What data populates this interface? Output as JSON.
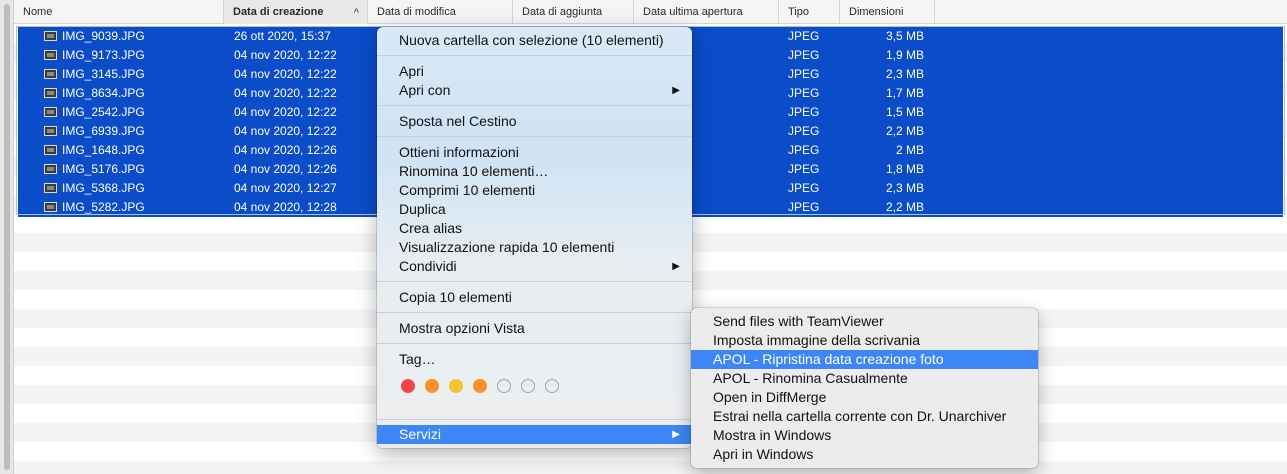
{
  "columns": {
    "name": "Nome",
    "created": "Data di creazione",
    "modified": "Data di modifica",
    "added": "Data di aggiunta",
    "last_opened": "Data ultima apertura",
    "type": "Tipo",
    "size": "Dimensioni"
  },
  "sort_indicator": "^",
  "files": [
    {
      "name": "IMG_9039.JPG",
      "created": "26 ott 2020, 15:37",
      "type": "JPEG",
      "size": "3,5 MB"
    },
    {
      "name": "IMG_9173.JPG",
      "created": "04 nov 2020, 12:22",
      "type": "JPEG",
      "size": "1,9 MB"
    },
    {
      "name": "IMG_3145.JPG",
      "created": "04 nov 2020, 12:22",
      "type": "JPEG",
      "size": "2,3 MB"
    },
    {
      "name": "IMG_8634.JPG",
      "created": "04 nov 2020, 12:22",
      "type": "JPEG",
      "size": "1,7 MB"
    },
    {
      "name": "IMG_2542.JPG",
      "created": "04 nov 2020, 12:22",
      "type": "JPEG",
      "size": "1,5 MB"
    },
    {
      "name": "IMG_6939.JPG",
      "created": "04 nov 2020, 12:22",
      "type": "JPEG",
      "size": "2,2 MB"
    },
    {
      "name": "IMG_1648.JPG",
      "created": "04 nov 2020, 12:26",
      "type": "JPEG",
      "size": "2 MB"
    },
    {
      "name": "IMG_5176.JPG",
      "created": "04 nov 2020, 12:26",
      "type": "JPEG",
      "size": "1,8 MB"
    },
    {
      "name": "IMG_5368.JPG",
      "created": "04 nov 2020, 12:27",
      "type": "JPEG",
      "size": "2,3 MB"
    },
    {
      "name": "IMG_5282.JPG",
      "created": "04 nov 2020, 12:28",
      "type": "JPEG",
      "size": "2,2 MB"
    }
  ],
  "context_menu": {
    "new_folder": "Nuova cartella con selezione (10 elementi)",
    "open": "Apri",
    "open_with": "Apri con",
    "move_to_trash": "Sposta nel Cestino",
    "get_info": "Ottieni informazioni",
    "rename": "Rinomina 10 elementi…",
    "compress": "Comprimi 10 elementi",
    "duplicate": "Duplica",
    "make_alias": "Crea alias",
    "quick_look": "Visualizzazione rapida 10 elementi",
    "share": "Condividi",
    "copy": "Copia 10 elementi",
    "view_options": "Mostra opzioni Vista",
    "tags": "Tag…",
    "services": "Servizi",
    "submenu_arrow": "▶"
  },
  "tag_colors": [
    "#f0454b",
    "#f6922a",
    "#f6c333",
    "#f6922a",
    "none",
    "none",
    "none"
  ],
  "services_submenu": [
    "Send files with TeamViewer",
    "Imposta immagine della scrivania",
    "APOL - Ripristina data creazione foto",
    "APOL - Rinomina Casualmente",
    "Open in DiffMerge",
    "Estrai nella cartella corrente con Dr. Unarchiver",
    "Mostra in Windows",
    "Apri in Windows"
  ],
  "highlighted_service": "APOL - Ripristina data creazione foto",
  "colors": {
    "selection": "#0b4cc8",
    "menu_highlight": "#3d86f6"
  }
}
